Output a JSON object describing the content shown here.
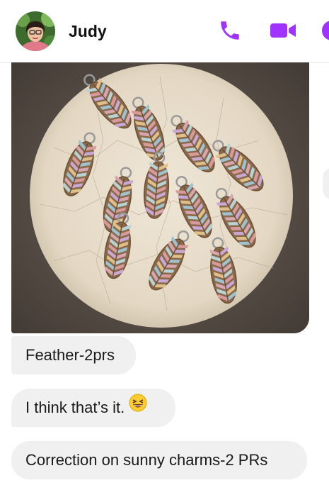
{
  "header": {
    "contact_name": "Judy",
    "avatar_icon": "user-avatar",
    "call_icon": "phone-icon",
    "video_icon": "video-camera-icon",
    "info_icon": "info-icon",
    "accent_color": "#a033ff"
  },
  "messages": [
    {
      "type": "image",
      "description_icon": "photo-feather-charms"
    },
    {
      "type": "text",
      "text": "Feather-2prs"
    },
    {
      "type": "text",
      "text": "I think that’s it.",
      "emoji_icon": "grinning-squinting-face-emoji"
    },
    {
      "type": "text",
      "text": "Correction on sunny charms-2 PRs"
    }
  ]
}
